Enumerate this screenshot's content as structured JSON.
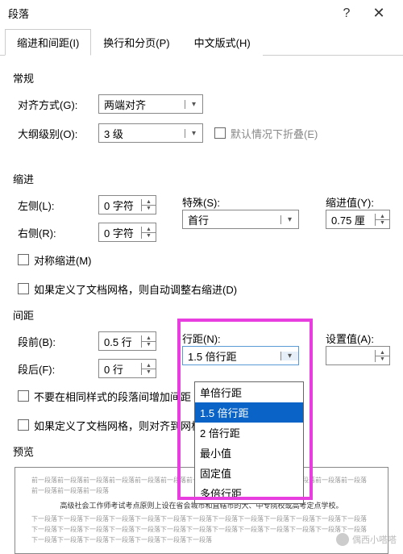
{
  "title": "段落",
  "tabs": [
    "缩进和间距(I)",
    "换行和分页(P)",
    "中文版式(H)"
  ],
  "active_tab": 0,
  "section_general": "常规",
  "align_label": "对齐方式(G):",
  "align_value": "两端对齐",
  "outline_label": "大纲级别(O):",
  "outline_value": "3 级",
  "collapse_label": "默认情况下折叠(E)",
  "section_indent": "缩进",
  "left_label": "左侧(L):",
  "left_value": "0 字符",
  "right_label": "右侧(R):",
  "right_value": "0 字符",
  "special_label": "特殊(S):",
  "special_value": "首行",
  "indent_by_label": "缩进值(Y):",
  "indent_by_value": "0.75 厘",
  "mirror_label": "对称缩进(M)",
  "auto_right_label": "如果定义了文档网格，则自动调整右缩进(D)",
  "section_spacing": "间距",
  "before_label": "段前(B):",
  "before_value": "0.5 行",
  "after_label": "段后(F):",
  "after_value": "0 行",
  "line_spacing_label": "行距(N):",
  "line_spacing_value": "1.5 倍行距",
  "at_label": "设置值(A):",
  "at_value": "",
  "no_space_label": "不要在相同样式的段落间增加间距",
  "snap_grid_label": "如果定义了文档网格，则对齐到网格",
  "preview_label": "预览",
  "line_spacing_options": [
    "单倍行距",
    "1.5 倍行距",
    "2 倍行距",
    "最小值",
    "固定值",
    "多倍行距"
  ],
  "line_spacing_selected": 1,
  "preview_gray1": "前一段落前一段落前一段落前一段落前一段落前一段落前一段落前一段落前一段落前一段落前一段落前一段落前一段落前一段落前一段落前一段落",
  "preview_main": "高级社会工作师考试考点原则上设在省会城市和直辖市的大、中专院校或高考定点学校。",
  "preview_gray2": "下一段落下一段落下一段落下一段落下一段落下一段落下一段落下一段落下一段落下一段落下一段落下一段落下一段落下一段落下一段落下一段落下一段落下一段落下一段落下一段落下一段落下一段落下一段落下一段落下一段落下一段落下一段落下一段落下一段落下一段落下一段落下一段落下一段落",
  "watermark": "偶西小嗒嗒"
}
